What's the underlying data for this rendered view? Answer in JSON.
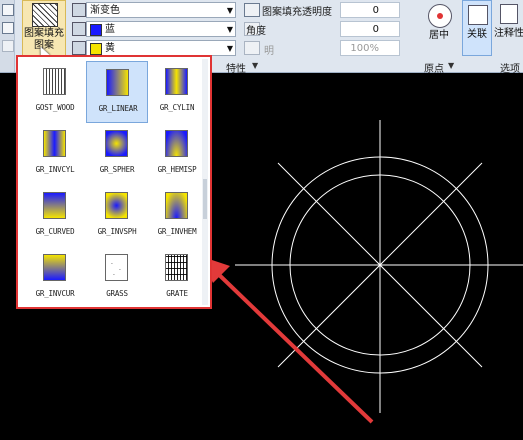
{
  "ribbon": {
    "pattern_button_label_1": "图案填充",
    "pattern_button_label_2": "图案",
    "type_combo": "渐变色",
    "color1_combo": "蓝",
    "color2_combo": "黄",
    "transparency_label": "图案填充透明度",
    "transparency_value": "0",
    "angle_label": "角度",
    "angle_value": "0",
    "ming_label": "明",
    "ming_value": "100%",
    "center_label": "居中",
    "assoc_label": "关联",
    "annot_label": "注释性",
    "properties_panel": "特性",
    "origin_panel": "原点",
    "options_panel": "选项",
    "colors": {
      "blue": "#1a1aff",
      "yellow": "#f5e400",
      "ribbon_bg": "#dfe6ef",
      "highlight": "#cfe3fb",
      "red": "#e03434"
    }
  },
  "gallery": {
    "items": [
      {
        "name": "GOST_WOOD",
        "kind": "hatch-wood"
      },
      {
        "name": "GR_LINEAR",
        "kind": "grad-linear",
        "selected": true
      },
      {
        "name": "GR_CYLIN",
        "kind": "grad-cylin"
      },
      {
        "name": "GR_INVCYL",
        "kind": "grad-invcyl"
      },
      {
        "name": "GR_SPHER",
        "kind": "grad-spher"
      },
      {
        "name": "GR_HEMISP",
        "kind": "grad-hemisp"
      },
      {
        "name": "GR_CURVED",
        "kind": "grad-curved"
      },
      {
        "name": "GR_INVSPH",
        "kind": "grad-invsph"
      },
      {
        "name": "GR_INVHEM",
        "kind": "grad-invhem"
      },
      {
        "name": "GR_INVCUR",
        "kind": "grad-invcur"
      },
      {
        "name": "GRASS",
        "kind": "hatch-grass"
      },
      {
        "name": "GRATE",
        "kind": "hatch-grate"
      }
    ]
  }
}
